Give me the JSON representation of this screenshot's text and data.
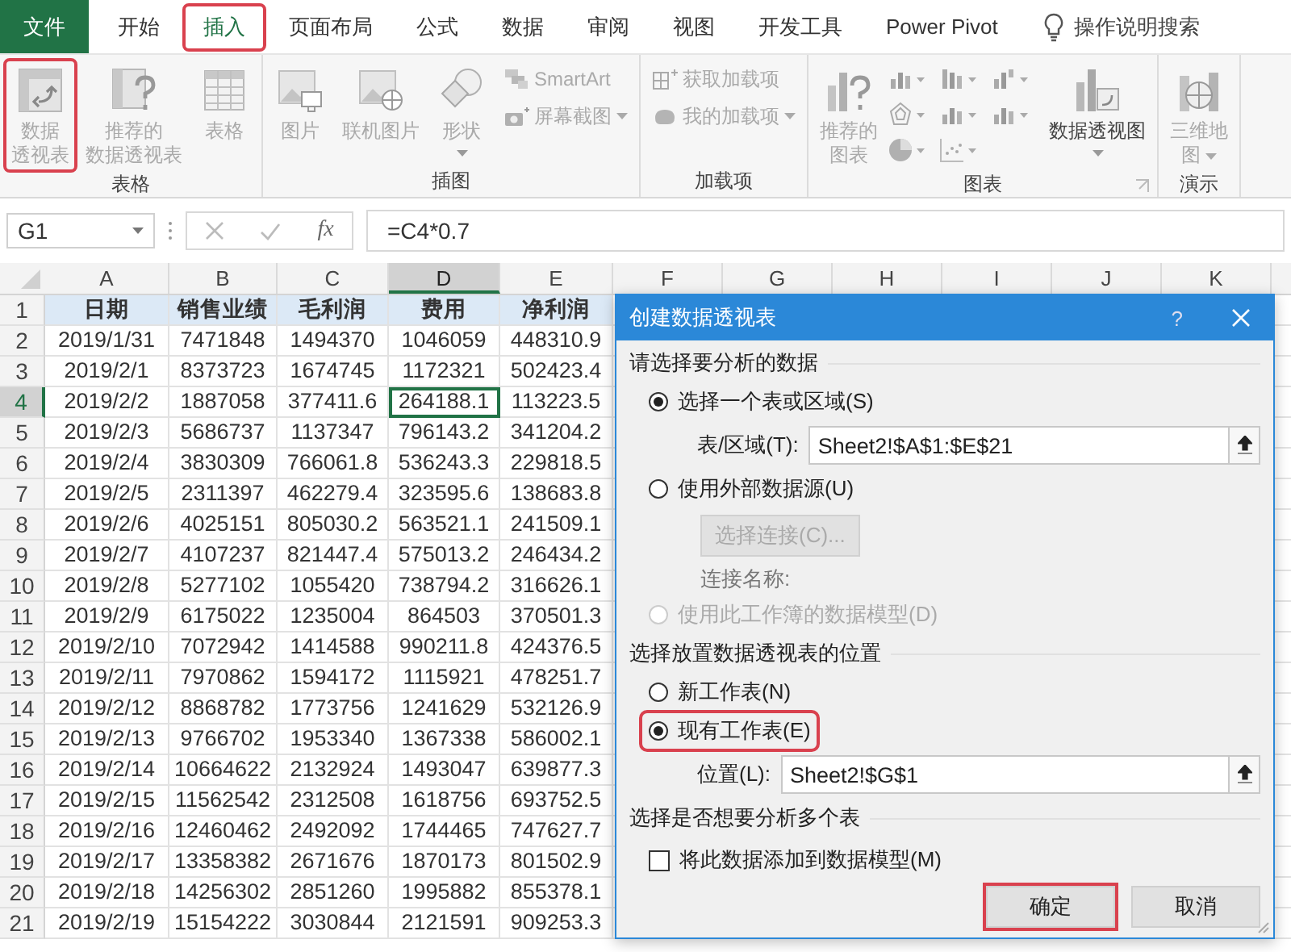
{
  "tabs": [
    {
      "label": "文件",
      "kind": "file",
      "selected": false,
      "highlighted": false
    },
    {
      "label": "开始",
      "kind": "tab",
      "selected": false,
      "highlighted": false
    },
    {
      "label": "插入",
      "kind": "tab",
      "selected": true,
      "highlighted": true
    },
    {
      "label": "页面布局",
      "kind": "tab",
      "selected": false,
      "highlighted": false
    },
    {
      "label": "公式",
      "kind": "tab",
      "selected": false,
      "highlighted": false
    },
    {
      "label": "数据",
      "kind": "tab",
      "selected": false,
      "highlighted": false
    },
    {
      "label": "审阅",
      "kind": "tab",
      "selected": false,
      "highlighted": false
    },
    {
      "label": "视图",
      "kind": "tab",
      "selected": false,
      "highlighted": false
    },
    {
      "label": "开发工具",
      "kind": "tab",
      "selected": false,
      "highlighted": false
    },
    {
      "label": "Power Pivot",
      "kind": "tab",
      "selected": false,
      "highlighted": false
    }
  ],
  "tell_me": "操作说明搜索",
  "ribbon_groups": [
    {
      "label": "表格",
      "items": [
        {
          "kind": "large",
          "lines": [
            "数据",
            "透视表"
          ],
          "disabled": true,
          "highlighted": true,
          "dropdown": false
        },
        {
          "kind": "large",
          "lines": [
            "推荐的",
            "数据透视表"
          ],
          "disabled": true,
          "highlighted": false,
          "dropdown": false
        },
        {
          "kind": "large",
          "lines": [
            "表格"
          ],
          "disabled": true,
          "highlighted": false,
          "dropdown": false
        }
      ]
    },
    {
      "label": "插图",
      "items": [
        {
          "kind": "large",
          "lines": [
            "图片"
          ],
          "disabled": true,
          "highlighted": false,
          "dropdown": false
        },
        {
          "kind": "large",
          "lines": [
            "联机图片"
          ],
          "disabled": true,
          "highlighted": false,
          "dropdown": false
        },
        {
          "kind": "large",
          "lines": [
            "形状"
          ],
          "disabled": true,
          "highlighted": false,
          "dropdown": true
        },
        {
          "kind": "stack",
          "items": [
            {
              "label": "SmartArt",
              "disabled": true,
              "dropdown": false
            },
            {
              "label": "屏幕截图",
              "disabled": true,
              "dropdown": true
            }
          ]
        }
      ]
    },
    {
      "label": "加载项",
      "items": [
        {
          "kind": "stack",
          "items": [
            {
              "label": "获取加载项",
              "disabled": true,
              "dropdown": false
            },
            {
              "label": "我的加载项",
              "disabled": true,
              "dropdown": true
            }
          ]
        }
      ]
    },
    {
      "label": "图表",
      "launcher": true,
      "items": [
        {
          "kind": "large",
          "lines": [
            "推荐的",
            "图表"
          ],
          "disabled": true,
          "highlighted": false,
          "dropdown": false
        },
        {
          "kind": "gallery"
        },
        {
          "kind": "large",
          "lines": [
            "数据透视图"
          ],
          "disabled": false,
          "highlighted": false,
          "dropdown": true
        }
      ]
    },
    {
      "label": "演示",
      "items": [
        {
          "kind": "large",
          "lines": [
            "三维地",
            "图"
          ],
          "disabled": true,
          "highlighted": false,
          "dropdown": true
        }
      ]
    }
  ],
  "formula_bar": {
    "name_box": "G1",
    "fx": "fx",
    "formula": "=C4*0.7"
  },
  "sheet": {
    "columns": [
      {
        "label": "A",
        "selected": false
      },
      {
        "label": "B",
        "selected": false
      },
      {
        "label": "C",
        "selected": false
      },
      {
        "label": "D",
        "selected": true
      },
      {
        "label": "E",
        "selected": false
      },
      {
        "label": "F",
        "selected": false
      },
      {
        "label": "G",
        "selected": false
      },
      {
        "label": "H",
        "selected": false
      },
      {
        "label": "I",
        "selected": false
      },
      {
        "label": "J",
        "selected": false
      },
      {
        "label": "K",
        "selected": false
      }
    ],
    "rows": [
      {
        "number": "1",
        "kind": "header",
        "selected": false,
        "cells": [
          "日期",
          "销售业绩",
          "毛利润",
          "费用",
          "净利润"
        ]
      },
      {
        "number": "2",
        "kind": "data",
        "selected": false,
        "cells": [
          "2019/1/31",
          "7471848",
          "1494370",
          "1046059",
          "448310.9"
        ]
      },
      {
        "number": "3",
        "kind": "data",
        "selected": false,
        "cells": [
          "2019/2/1",
          "8373723",
          "1674745",
          "1172321",
          "502423.4"
        ]
      },
      {
        "number": "4",
        "kind": "data",
        "selected": true,
        "cells": [
          "2019/2/2",
          "1887058",
          "377411.6",
          "264188.1",
          "113223.5"
        ]
      },
      {
        "number": "5",
        "kind": "data",
        "selected": false,
        "cells": [
          "2019/2/3",
          "5686737",
          "1137347",
          "796143.2",
          "341204.2"
        ]
      },
      {
        "number": "6",
        "kind": "data",
        "selected": false,
        "cells": [
          "2019/2/4",
          "3830309",
          "766061.8",
          "536243.3",
          "229818.5"
        ]
      },
      {
        "number": "7",
        "kind": "data",
        "selected": false,
        "cells": [
          "2019/2/5",
          "2311397",
          "462279.4",
          "323595.6",
          "138683.8"
        ]
      },
      {
        "number": "8",
        "kind": "data",
        "selected": false,
        "cells": [
          "2019/2/6",
          "4025151",
          "805030.2",
          "563521.1",
          "241509.1"
        ]
      },
      {
        "number": "9",
        "kind": "data",
        "selected": false,
        "cells": [
          "2019/2/7",
          "4107237",
          "821447.4",
          "575013.2",
          "246434.2"
        ]
      },
      {
        "number": "10",
        "kind": "data",
        "selected": false,
        "cells": [
          "2019/2/8",
          "5277102",
          "1055420",
          "738794.2",
          "316626.1"
        ]
      },
      {
        "number": "11",
        "kind": "data",
        "selected": false,
        "cells": [
          "2019/2/9",
          "6175022",
          "1235004",
          "864503",
          "370501.3"
        ]
      },
      {
        "number": "12",
        "kind": "data",
        "selected": false,
        "cells": [
          "2019/2/10",
          "7072942",
          "1414588",
          "990211.8",
          "424376.5"
        ]
      },
      {
        "number": "13",
        "kind": "data",
        "selected": false,
        "cells": [
          "2019/2/11",
          "7970862",
          "1594172",
          "1115921",
          "478251.7"
        ]
      },
      {
        "number": "14",
        "kind": "data",
        "selected": false,
        "cells": [
          "2019/2/12",
          "8868782",
          "1773756",
          "1241629",
          "532126.9"
        ]
      },
      {
        "number": "15",
        "kind": "data",
        "selected": false,
        "cells": [
          "2019/2/13",
          "9766702",
          "1953340",
          "1367338",
          "586002.1"
        ]
      },
      {
        "number": "16",
        "kind": "data",
        "selected": false,
        "cells": [
          "2019/2/14",
          "10664622",
          "2132924",
          "1493047",
          "639877.3"
        ]
      },
      {
        "number": "17",
        "kind": "data",
        "selected": false,
        "cells": [
          "2019/2/15",
          "11562542",
          "2312508",
          "1618756",
          "693752.5"
        ]
      },
      {
        "number": "18",
        "kind": "data",
        "selected": false,
        "cells": [
          "2019/2/16",
          "12460462",
          "2492092",
          "1744465",
          "747627.7"
        ]
      },
      {
        "number": "19",
        "kind": "data",
        "selected": false,
        "cells": [
          "2019/2/17",
          "13358382",
          "2671676",
          "1870173",
          "801502.9"
        ]
      },
      {
        "number": "20",
        "kind": "data",
        "selected": false,
        "cells": [
          "2019/2/18",
          "14256302",
          "2851260",
          "1995882",
          "855378.1"
        ]
      },
      {
        "number": "21",
        "kind": "data",
        "selected": false,
        "cells": [
          "2019/2/19",
          "15154222",
          "3030844",
          "2121591",
          "909253.3"
        ]
      }
    ]
  },
  "dialog": {
    "title": "创建数据透视表",
    "help": "?",
    "rows": [
      {
        "kind": "heading",
        "text": "请选择要分析的数据"
      },
      {
        "kind": "radio",
        "label": "选择一个表或区域(S)",
        "selected": true,
        "disabled": false,
        "highlighted": false
      },
      {
        "kind": "field",
        "label": "表/区域(T):",
        "value": "Sheet2!$A$1:$E$21"
      },
      {
        "kind": "radio",
        "label": "使用外部数据源(U)",
        "selected": false,
        "disabled": false,
        "highlighted": false
      },
      {
        "kind": "button",
        "label": "选择连接(C)...",
        "disabled": true
      },
      {
        "kind": "note",
        "text": "连接名称:"
      },
      {
        "kind": "radio",
        "label": "使用此工作簿的数据模型(D)",
        "selected": false,
        "disabled": true,
        "highlighted": false
      },
      {
        "kind": "heading",
        "text": "选择放置数据透视表的位置"
      },
      {
        "kind": "radio",
        "label": "新工作表(N)",
        "selected": false,
        "disabled": false,
        "highlighted": false
      },
      {
        "kind": "radio",
        "label": "现有工作表(E)",
        "selected": true,
        "disabled": false,
        "highlighted": true
      },
      {
        "kind": "field",
        "label": "位置(L):",
        "value": "Sheet2!$G$1"
      },
      {
        "kind": "heading",
        "text": "选择是否想要分析多个表"
      },
      {
        "kind": "checkbox",
        "label": "将此数据添加到数据模型(M)",
        "checked": false
      }
    ],
    "buttons": [
      {
        "label": "确定",
        "highlighted": true
      },
      {
        "label": "取消",
        "highlighted": false
      }
    ]
  }
}
